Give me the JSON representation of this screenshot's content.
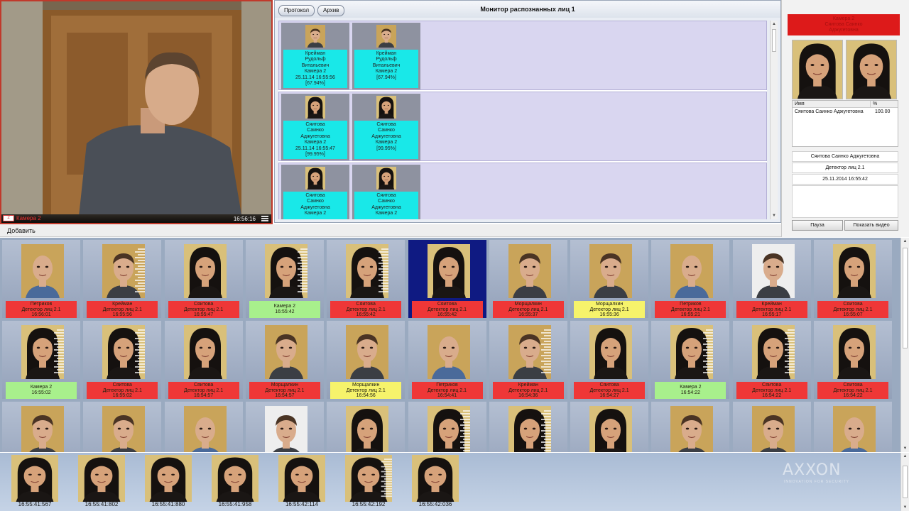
{
  "colors": {
    "alarm_red": "#ef3737",
    "ok_green": "#a8f08c",
    "warn_yellow": "#f6f36b",
    "match_cyan": "#19e8e8",
    "selected_navy": "#0f1a82"
  },
  "camera": {
    "time": "16:56:16",
    "label": "Камера 2",
    "icon": "camera-icon",
    "menu_icon": "menu-icon"
  },
  "monitor": {
    "title": "Монитор распознанных лиц 1",
    "tabs": [
      "Протокол",
      "Архив"
    ],
    "rows": [
      {
        "captured": {
          "face": "man",
          "lines": [
            "Крейман",
            "Рудольф",
            "Витальевич",
            "Камера 2",
            "25.11.14 16:55:56",
            "[67.94%]"
          ]
        },
        "reference": {
          "face": "man",
          "lines": [
            "Крейман",
            "Рудольф",
            "Витальевич",
            "Камера 2",
            "[67.94%]"
          ]
        }
      },
      {
        "captured": {
          "face": "woman",
          "lines": [
            "Сяитова",
            "Саинко",
            "Аджугетовна",
            "Камера 2",
            "25.11.14 16:55:47",
            "[99.95%]"
          ]
        },
        "reference": {
          "face": "woman",
          "lines": [
            "Сяитова",
            "Саинко",
            "Аджугетовна",
            "Камера 2",
            "[99.95%]"
          ]
        }
      },
      {
        "captured": {
          "face": "woman",
          "lines": [
            "Сяитова",
            "Саинко",
            "Аджугетовна",
            "Камера 2"
          ]
        },
        "reference": {
          "face": "woman",
          "lines": [
            "Сяитова",
            "Саинко",
            "Аджугетовна",
            "Камера 2"
          ]
        }
      }
    ]
  },
  "info": {
    "alarm_lines": [
      "Камера 2",
      "Сяитова Саинко",
      "Аджугетовна"
    ],
    "table_headers": [
      "Имя",
      "%"
    ],
    "table_name": "Сяитова Саинко Аджугетовна",
    "table_percent": "100.00",
    "name_field": "Сяитова Саинко Аджугетовна",
    "detector_field": "Детектор лиц 2.1",
    "datetime_field": "25.11.2014 16:55:42",
    "pause_button": "Пауза",
    "show_video_button": "Показать видео"
  },
  "addbar": {
    "label": "Добавить"
  },
  "gallery": [
    {
      "face": "bald",
      "status": "red",
      "lines": [
        "Петриков",
        "Детектор лиц 2.1",
        "16:56:01"
      ]
    },
    {
      "face": "man-glitch",
      "status": "red",
      "lines": [
        "Крейман",
        "Детектор лиц 2.1",
        "16:55:56"
      ]
    },
    {
      "face": "woman",
      "status": "red",
      "lines": [
        "Сяитова",
        "Детектор лиц 2.1",
        "16:55:47"
      ]
    },
    {
      "face": "woman-glitch",
      "status": "green",
      "lines": [
        "Камера 2",
        "16:55:42"
      ]
    },
    {
      "face": "woman-glitch",
      "status": "red",
      "lines": [
        "Сяитова",
        "Детектор лиц 2.1",
        "16:55:42"
      ]
    },
    {
      "face": "woman",
      "status": "red",
      "selected": true,
      "lines": [
        "Сяитова",
        "Детектор лиц 2.1",
        "16:55:42"
      ]
    },
    {
      "face": "man",
      "status": "red",
      "lines": [
        "Морщалкин",
        "Детектор лиц 2.1",
        "16:55:37"
      ]
    },
    {
      "face": "man",
      "status": "yellow",
      "lines": [
        "Морщалкин",
        "Детектор лиц 2.1",
        "16:55:36"
      ]
    },
    {
      "face": "bald",
      "status": "red",
      "lines": [
        "Петриков",
        "Детектор лиц 2.1",
        "16:55:21"
      ]
    },
    {
      "face": "man-light",
      "status": "red",
      "lines": [
        "Крейман",
        "Детектор лиц 2.1",
        "16:55:17"
      ]
    },
    {
      "face": "woman",
      "status": "red",
      "lines": [
        "Сяитова",
        "Детектор лиц 2.1",
        "16:55:07"
      ]
    },
    {
      "face": "woman-glitch",
      "status": "green",
      "lines": [
        "Камера 2",
        "16:55:02"
      ]
    },
    {
      "face": "woman-glitch",
      "status": "red",
      "lines": [
        "Сяитова",
        "Детектор лиц 2.1",
        "16:55:02"
      ]
    },
    {
      "face": "woman",
      "status": "red",
      "lines": [
        "Сяитова",
        "Детектор лиц 2.1",
        "16:54:57"
      ]
    },
    {
      "face": "man",
      "status": "red",
      "lines": [
        "Морщалкин",
        "Детектор лиц 2.1",
        "16:54:57"
      ]
    },
    {
      "face": "man",
      "status": "yellow",
      "lines": [
        "Морщалкин",
        "Детектор лиц 2.1",
        "16:54:56"
      ]
    },
    {
      "face": "bald",
      "status": "red",
      "lines": [
        "Петриков",
        "Детектор лиц 2.1",
        "16:54:41"
      ]
    },
    {
      "face": "man-glitch",
      "status": "red",
      "lines": [
        "Крейман",
        "Детектор лиц 2.1",
        "16:54:36"
      ]
    },
    {
      "face": "woman",
      "status": "red",
      "lines": [
        "Сяитова",
        "Детектор лиц 2.1",
        "16:54:27"
      ]
    },
    {
      "face": "woman-glitch",
      "status": "green",
      "lines": [
        "Камера 2",
        "16:54:22"
      ]
    },
    {
      "face": "woman-glitch",
      "status": "red",
      "lines": [
        "Сяитова",
        "Детектор лиц 2.1",
        "16:54:22"
      ]
    },
    {
      "face": "woman",
      "status": "red",
      "lines": [
        "Сяитова",
        "Детектор лиц 2.1",
        "16:54:22"
      ]
    },
    {
      "face": "man",
      "status": "none",
      "lines": []
    },
    {
      "face": "man",
      "status": "none",
      "lines": []
    },
    {
      "face": "bald",
      "status": "none",
      "lines": []
    },
    {
      "face": "man-light",
      "status": "none",
      "lines": []
    },
    {
      "face": "woman",
      "status": "none",
      "lines": []
    },
    {
      "face": "woman-glitch",
      "status": "none",
      "lines": []
    },
    {
      "face": "woman-glitch",
      "status": "none",
      "lines": []
    },
    {
      "face": "woman",
      "status": "none",
      "lines": []
    },
    {
      "face": "man",
      "status": "none",
      "lines": []
    },
    {
      "face": "man",
      "status": "none",
      "lines": []
    },
    {
      "face": "bald",
      "status": "none",
      "lines": []
    }
  ],
  "strip": {
    "faces": [
      "woman",
      "woman",
      "woman",
      "woman",
      "woman",
      "woman-glitch",
      "woman"
    ],
    "times": [
      "16:55:41:567",
      "16:55:41:802",
      "16:55:41:880",
      "16:55:41:958",
      "16:55:42:114",
      "16:55:42:192",
      "16:55:42:036"
    ]
  },
  "logo": {
    "text": "AXXON",
    "subtitle": "INNOVATION FOR SECURITY"
  }
}
